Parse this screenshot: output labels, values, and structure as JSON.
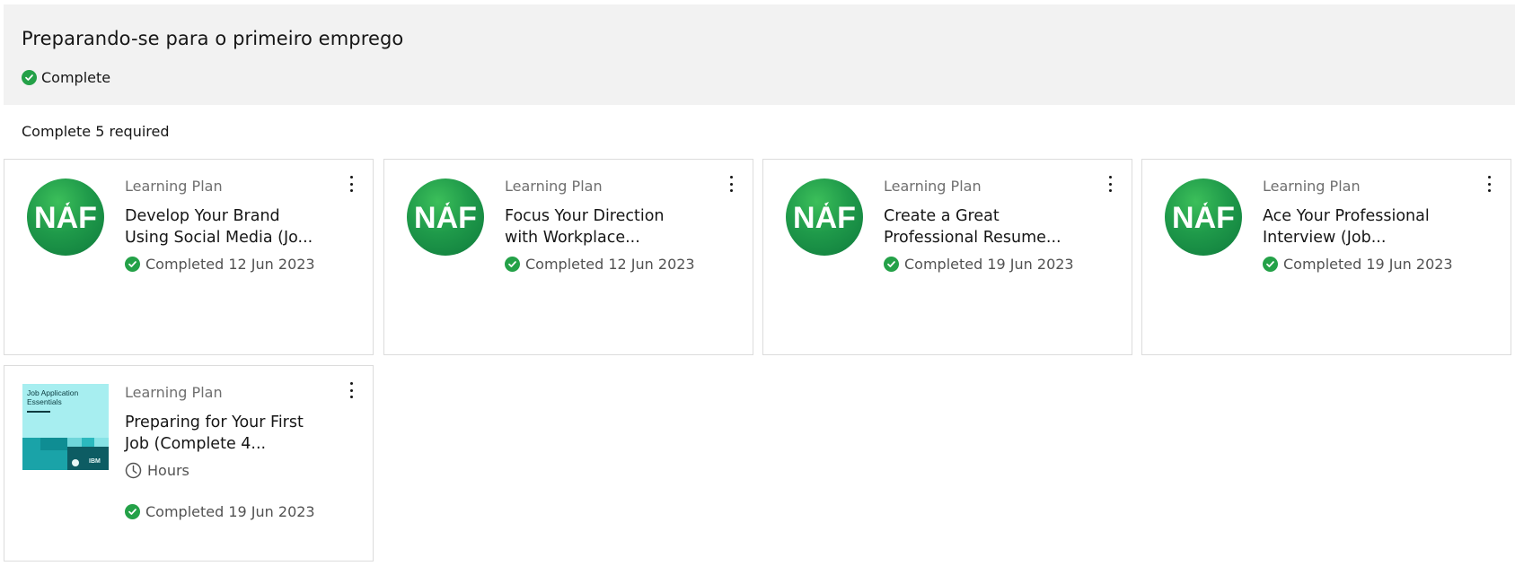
{
  "section": {
    "title": "Preparando-se para o primeiro emprego",
    "status": "Complete",
    "requirement": "Complete 5 required"
  },
  "colors": {
    "success": "#24a148",
    "header_bg": "#f2f2f2",
    "naf_green": "#1f9a4a",
    "thumb_teal": "#a7eef0"
  },
  "cards": [
    {
      "type": "Learning Plan",
      "title_line1": "Develop Your Brand",
      "title_line2": "Using Social Media (Jo...",
      "status": "Completed 12 Jun 2023",
      "logo_text": "NAF"
    },
    {
      "type": "Learning Plan",
      "title_line1": "Focus Your Direction",
      "title_line2": "with Workplace...",
      "status": "Completed 12 Jun 2023",
      "logo_text": "NAF"
    },
    {
      "type": "Learning Plan",
      "title_line1": "Create a Great",
      "title_line2": "Professional Resume...",
      "status": "Completed 19 Jun 2023",
      "logo_text": "NAF"
    },
    {
      "type": "Learning Plan",
      "title_line1": "Ace Your Professional",
      "title_line2": "Interview (Job...",
      "status": "Completed 19 Jun 2023",
      "logo_text": "NAF"
    },
    {
      "type": "Learning Plan",
      "title_line1": "Preparing for Your First",
      "title_line2": "Job (Complete 4...",
      "duration": "Hours",
      "status": "Completed 19 Jun 2023",
      "thumb_title_line1": "Job Application",
      "thumb_title_line2": "Essentials",
      "thumb_brand": "IBM"
    }
  ]
}
